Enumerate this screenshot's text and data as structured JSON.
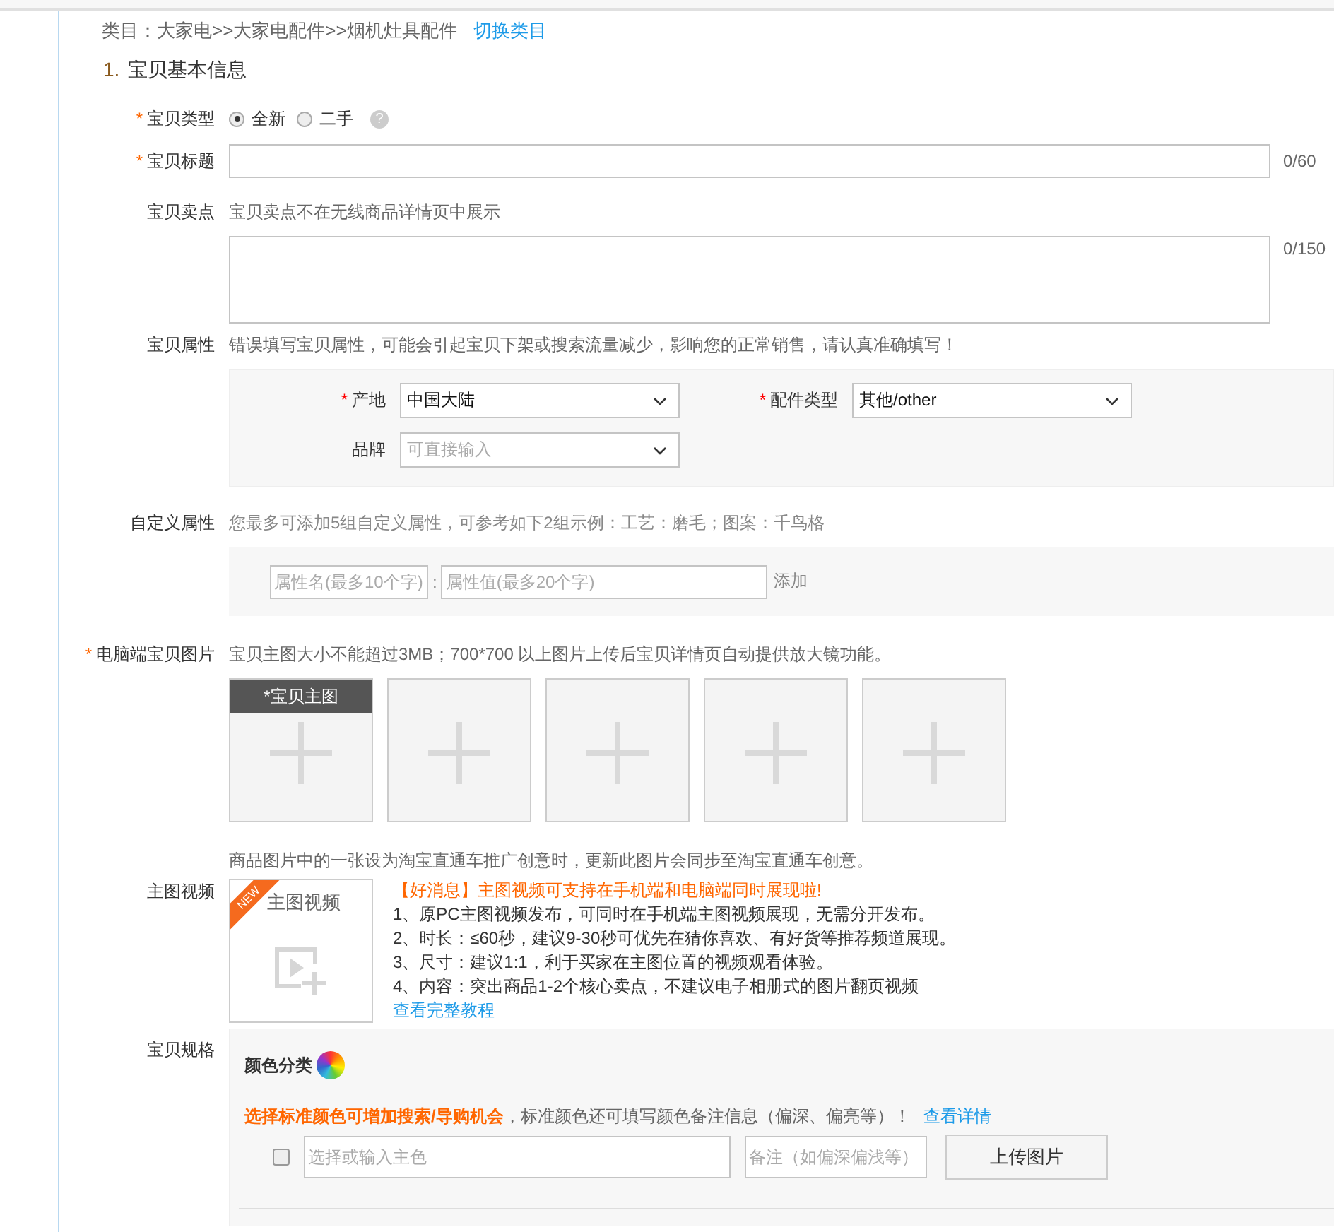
{
  "category": {
    "path": "类目：大家电>>大家电配件>>烟机灶具配件",
    "switch_link": "切换类目"
  },
  "section": {
    "number": "1.",
    "title": "宝贝基本信息"
  },
  "item_type": {
    "label": "宝贝类型",
    "required_mark": "*",
    "options": [
      {
        "label": "全新",
        "selected": true
      },
      {
        "label": "二手",
        "selected": false
      }
    ],
    "help": "?"
  },
  "item_title": {
    "label": "宝贝标题",
    "required_mark": "*",
    "counter": "0/60"
  },
  "selling_point": {
    "label": "宝贝卖点",
    "hint": "宝贝卖点不在无线商品详情页中展示",
    "counter": "0/150"
  },
  "attributes": {
    "label": "宝贝属性",
    "hint": "错误填写宝贝属性，可能会引起宝贝下架或搜索流量减少，影响您的正常销售，请认真准确填写！",
    "fields": [
      {
        "label": "产地",
        "required_mark": "*",
        "value": "中国大陆"
      },
      {
        "label": "配件类型",
        "required_mark": "*",
        "value": "其他/other"
      },
      {
        "label": "品牌",
        "placeholder": "可直接输入"
      }
    ]
  },
  "custom_attributes": {
    "label": "自定义属性",
    "hint": "您最多可添加5组自定义属性，可参考如下2组示例：工艺：磨毛；图案：千鸟格",
    "name_placeholder": "属性名(最多10个字)",
    "separator": ":",
    "value_placeholder": "属性值(最多20个字)",
    "add": "添加"
  },
  "pc_images": {
    "label": "电脑端宝贝图片",
    "required_mark": "*",
    "hint": "宝贝主图大小不能超过3MB；700*700 以上图片上传后宝贝详情页自动提供放大镜功能。",
    "slots": [
      {
        "kind": "main",
        "mark": "*",
        "caption": "宝贝主图"
      },
      {
        "kind": "empty"
      },
      {
        "kind": "empty"
      },
      {
        "kind": "empty"
      },
      {
        "kind": "empty"
      }
    ],
    "note": "商品图片中的一张设为淘宝直通车推广创意时，更新此图片会同步至淘宝直通车创意。"
  },
  "main_video": {
    "label": "主图视频",
    "badge": "NEW",
    "caption": "主图视频",
    "headline": "【好消息】主图视频可支持在手机端和电脑端同时展现啦!",
    "lines": [
      "1、原PC主图视频发布，可同时在手机端主图视频展现，无需分开发布。",
      "2、时长：≤60秒，建议9-30秒可优先在猜你喜欢、有好货等推荐频道展现。",
      "3、尺寸：建议1:1，利于买家在主图位置的视频观看体验。",
      "4、内容：突出商品1-2个核心卖点，不建议电子相册式的图片翻页视频"
    ],
    "link": "查看完整教程"
  },
  "spec": {
    "label": "宝贝规格",
    "group_title": "颜色分类",
    "promo": "**选择标准颜色可增加搜索/导购机会**，标准颜色还可填写颜色备注信息（偏深、偏亮等）！",
    "detail_link": "查看详情",
    "color_row": {
      "checked": false,
      "color_placeholder": "选择或输入主色",
      "note_placeholder": "备注（如偏深偏浅等）",
      "upload": "上传图片"
    }
  }
}
